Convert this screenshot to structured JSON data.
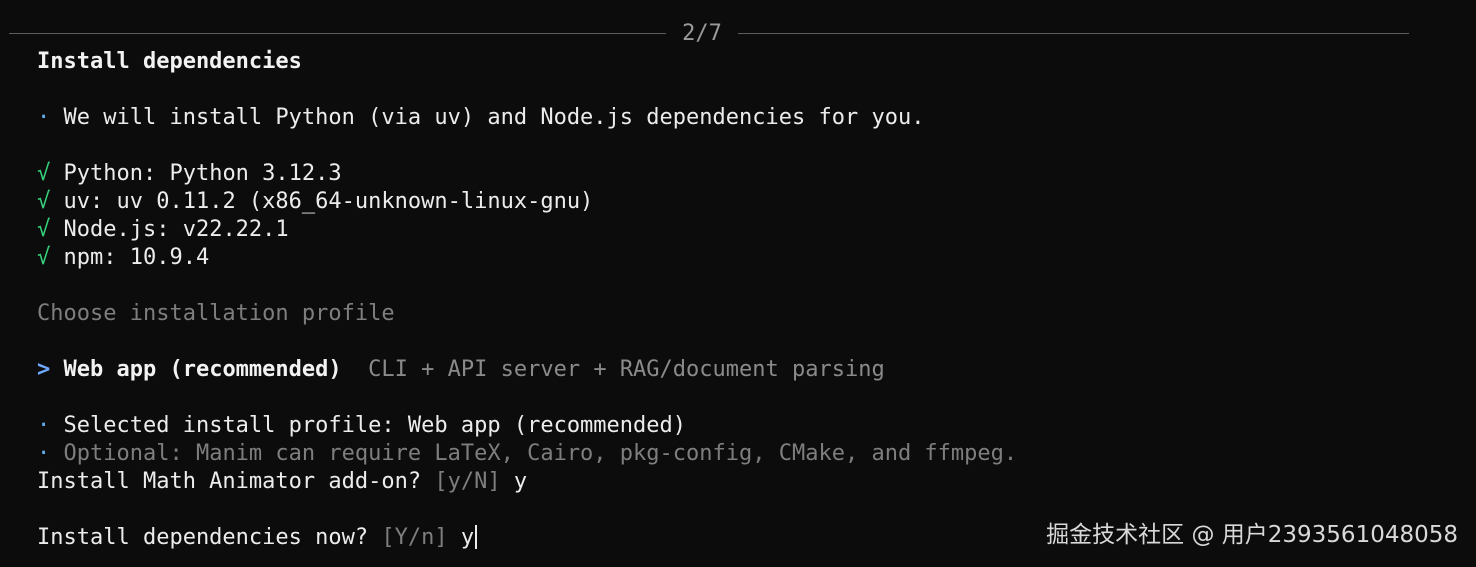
{
  "header": {
    "step": "2/7"
  },
  "section": {
    "title": "Install dependencies"
  },
  "intro": {
    "bullet": "·",
    "text": "We will install Python (via uv) and Node.js dependencies for you."
  },
  "checks": [
    {
      "mark": "√",
      "text": "Python: Python 3.12.3"
    },
    {
      "mark": "√",
      "text": "uv: uv 0.11.2 (x86_64-unknown-linux-gnu)"
    },
    {
      "mark": "√",
      "text": "Node.js: v22.22.1"
    },
    {
      "mark": "√",
      "text": "npm: 10.9.4"
    }
  ],
  "profile": {
    "prompt": "Choose installation profile",
    "pointer": ">",
    "option_label": "Web app (recommended)",
    "option_description": "CLI + API server + RAG/document parsing",
    "selected_bullet": "·",
    "selected_text": "Selected install profile: Web app (recommended)",
    "optional_bullet": "·",
    "optional_text": "Optional: Manim can require LaTeX, Cairo, pkg-config, CMake, and ffmpeg."
  },
  "prompts": {
    "math_question": "Install Math Animator add-on?",
    "math_hint": "[y/N]",
    "math_answer": "y",
    "deps_question": "Install dependencies now?",
    "deps_hint": "[Y/n]",
    "deps_answer": "y"
  },
  "watermark": {
    "text": "掘金技术社区 @ 用户2393561048058"
  },
  "colors": {
    "background": "#0c0c0c",
    "check": "#36d47c",
    "bullet": "#61afef",
    "pointer": "#6ea8ff",
    "dim": "#7e7e7e"
  }
}
